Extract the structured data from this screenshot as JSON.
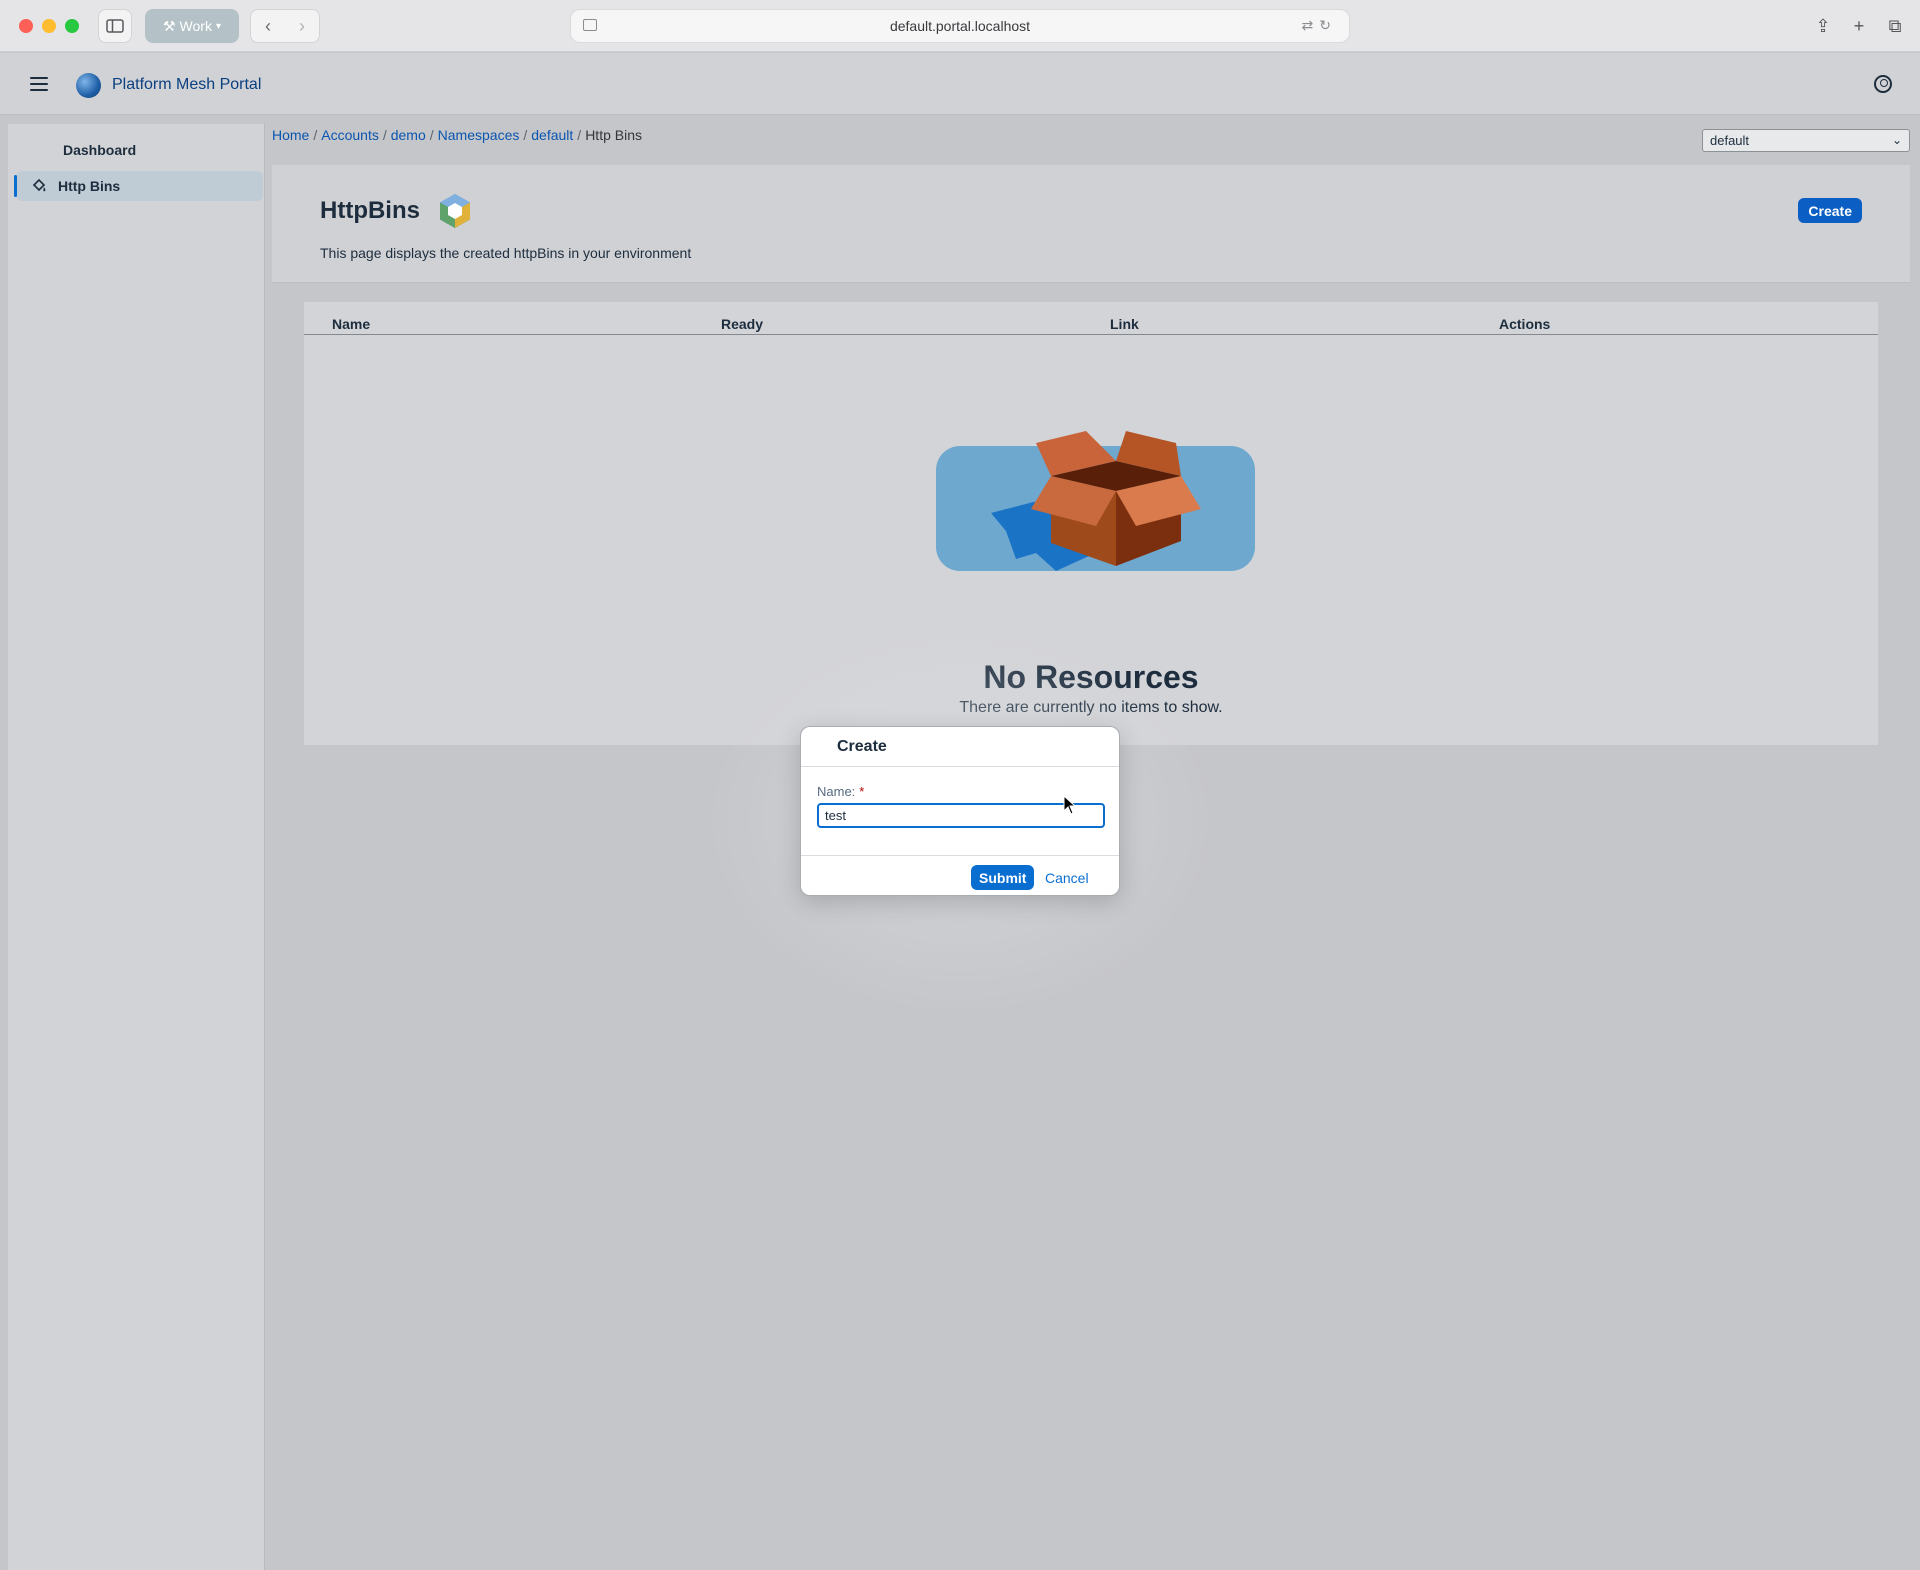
{
  "browser": {
    "profile_label": "Work",
    "url": "default.portal.localhost"
  },
  "shell": {
    "title": "Platform Mesh Portal"
  },
  "sidebar": {
    "items": [
      {
        "label": "Dashboard"
      },
      {
        "label": "Http Bins",
        "selected": true
      }
    ]
  },
  "breadcrumb": {
    "items": [
      "Home",
      "Accounts",
      "demo",
      "Namespaces",
      "default"
    ],
    "current": "Http Bins",
    "separator": "/"
  },
  "namespace_select": {
    "value": "default"
  },
  "page": {
    "title": "HttpBins",
    "description": "This page displays the created httpBins in your environment",
    "create_label": "Create"
  },
  "table": {
    "columns": [
      "Name",
      "Ready",
      "Link",
      "Actions"
    ],
    "rows": []
  },
  "empty_state": {
    "title": "No Resources",
    "subtitle": "There are currently no items to show."
  },
  "dialog": {
    "title": "Create",
    "field_label": "Name:",
    "required_mark": "*",
    "name_value": "test",
    "submit_label": "Submit",
    "cancel_label": "Cancel"
  },
  "colors": {
    "accent": "#0a6ed1",
    "link": "#0a55b0",
    "text": "#1d2d3e",
    "overlay_background": "#c5c6c9"
  },
  "icons": [
    "sidebar-toggle-icon",
    "hammer-icon",
    "back-icon",
    "forward-icon",
    "share-icon",
    "plus-icon",
    "tabs-icon",
    "menu-icon",
    "globe-logo-icon",
    "user-icon",
    "paint-bucket-icon",
    "cube-icon",
    "box-illustration"
  ]
}
